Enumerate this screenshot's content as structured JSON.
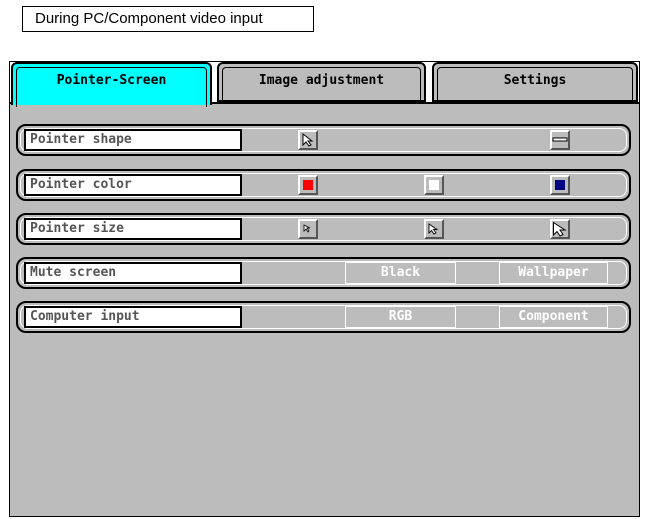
{
  "caption": "During PC/Component video input",
  "tabs": [
    {
      "label": "Pointer-Screen",
      "active": true
    },
    {
      "label": "Image adjustment",
      "active": false
    },
    {
      "label": "Settings",
      "active": false
    }
  ],
  "rows": {
    "pointer_shape": {
      "label": "Pointer shape",
      "options": [
        "arrow-pointer-icon",
        "bar-pointer-icon"
      ]
    },
    "pointer_color": {
      "label": "Pointer color",
      "options": [
        "#ff0000",
        "#ffffff",
        "#000080"
      ]
    },
    "pointer_size": {
      "label": "Pointer size",
      "options": [
        "small",
        "medium",
        "large"
      ]
    },
    "mute_screen": {
      "label": "Mute screen",
      "options": [
        "Black",
        "Wallpaper"
      ]
    },
    "computer_input": {
      "label": "Computer input",
      "options": [
        "RGB",
        "Component"
      ]
    }
  }
}
